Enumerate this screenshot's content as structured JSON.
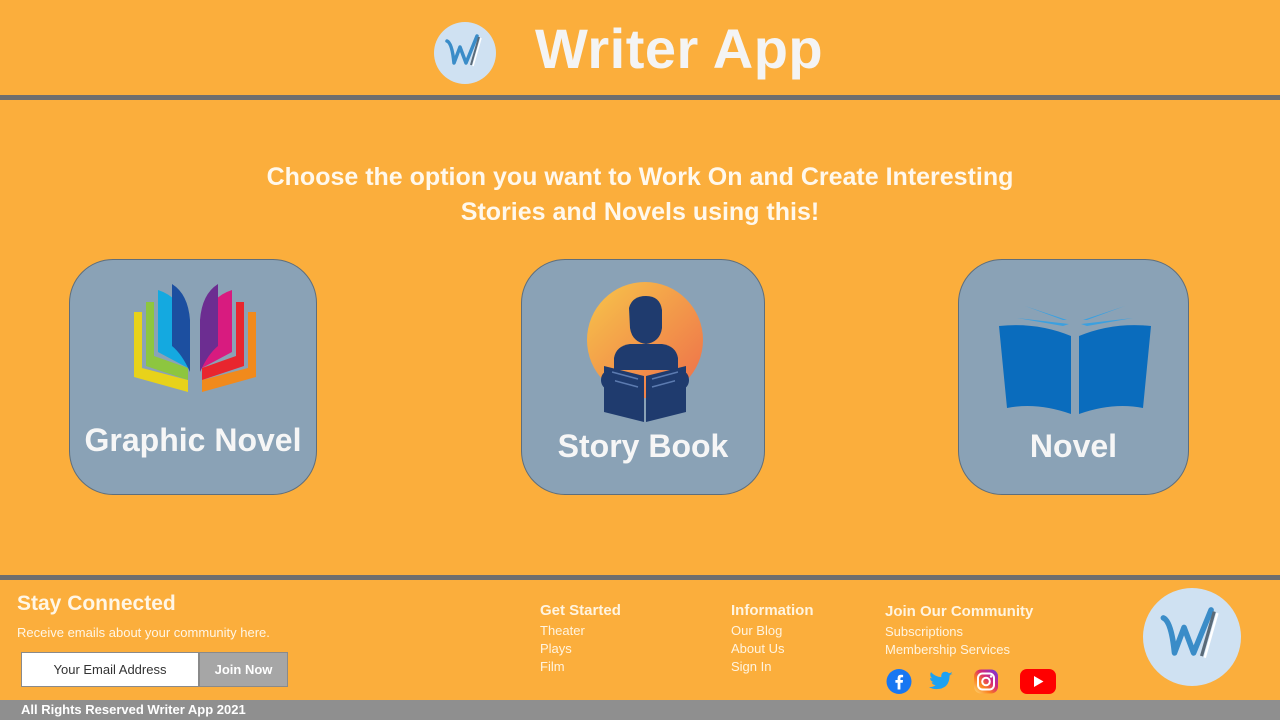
{
  "header": {
    "app_title": "Writer App",
    "logo_icon": "writer-app-logo"
  },
  "intro": {
    "line1": "Choose the option you want to Work On and Create Interesting",
    "line2": "Stories and Novels using this!"
  },
  "cards": [
    {
      "label": "Graphic Novel",
      "icon": "colorful-book-icon"
    },
    {
      "label": "Story Book",
      "icon": "reader-silhouette-icon"
    },
    {
      "label": "Novel",
      "icon": "open-book-icon"
    }
  ],
  "footer": {
    "stay_connected": {
      "title": "Stay Connected",
      "subtitle": "Receive emails about your community here.",
      "email_placeholder": "Your Email Address",
      "join_label": "Join Now"
    },
    "get_started": {
      "title": "Get Started",
      "links": [
        "Theater",
        "Plays",
        "Film"
      ]
    },
    "information": {
      "title": "Information",
      "links": [
        "Our Blog",
        "About Us",
        "Sign In"
      ]
    },
    "community": {
      "title": "Join Our Community",
      "links": [
        "Subscriptions",
        "Membership Services"
      ],
      "social": [
        "facebook-icon",
        "twitter-icon",
        "instagram-icon",
        "youtube-icon"
      ]
    },
    "copyright": "All Rights Reserved Writer App 2021"
  },
  "colors": {
    "background": "#FBAE3C",
    "card": "#8AA2B6",
    "rule": "#6E6E6E",
    "bottom_bar": "#8F8F8F",
    "logo_circle": "#CFE1F2"
  }
}
